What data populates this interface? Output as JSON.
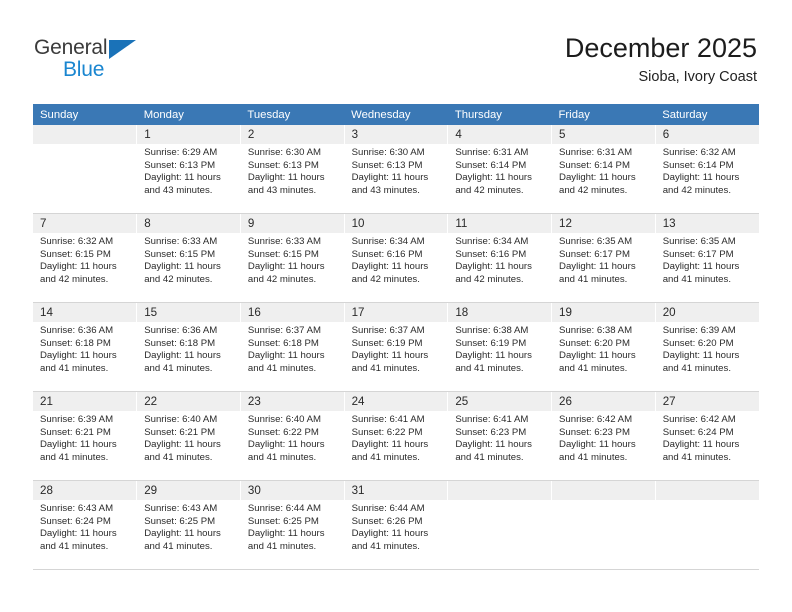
{
  "brand": {
    "name_part1": "General",
    "name_part2": "Blue",
    "triangle_color": "#1a72b8",
    "blue_text_color": "#1a86d0"
  },
  "header": {
    "title": "December 2025",
    "subtitle": "Sioba, Ivory Coast",
    "header_bg_color": "#3a78b5",
    "daynum_bg_color": "#efefef"
  },
  "weekdays": [
    "Sunday",
    "Monday",
    "Tuesday",
    "Wednesday",
    "Thursday",
    "Friday",
    "Saturday"
  ],
  "labels": {
    "sunrise_prefix": "Sunrise: ",
    "sunset_prefix": "Sunset: ",
    "daylight_prefix": "Daylight: "
  },
  "weeks": [
    [
      {
        "day": "",
        "sunrise": "",
        "sunset": "",
        "daylight_line1": "",
        "daylight_line2": ""
      },
      {
        "day": "1",
        "sunrise": "Sunrise: 6:29 AM",
        "sunset": "Sunset: 6:13 PM",
        "daylight_line1": "Daylight: 11 hours",
        "daylight_line2": "and 43 minutes."
      },
      {
        "day": "2",
        "sunrise": "Sunrise: 6:30 AM",
        "sunset": "Sunset: 6:13 PM",
        "daylight_line1": "Daylight: 11 hours",
        "daylight_line2": "and 43 minutes."
      },
      {
        "day": "3",
        "sunrise": "Sunrise: 6:30 AM",
        "sunset": "Sunset: 6:13 PM",
        "daylight_line1": "Daylight: 11 hours",
        "daylight_line2": "and 43 minutes."
      },
      {
        "day": "4",
        "sunrise": "Sunrise: 6:31 AM",
        "sunset": "Sunset: 6:14 PM",
        "daylight_line1": "Daylight: 11 hours",
        "daylight_line2": "and 42 minutes."
      },
      {
        "day": "5",
        "sunrise": "Sunrise: 6:31 AM",
        "sunset": "Sunset: 6:14 PM",
        "daylight_line1": "Daylight: 11 hours",
        "daylight_line2": "and 42 minutes."
      },
      {
        "day": "6",
        "sunrise": "Sunrise: 6:32 AM",
        "sunset": "Sunset: 6:14 PM",
        "daylight_line1": "Daylight: 11 hours",
        "daylight_line2": "and 42 minutes."
      }
    ],
    [
      {
        "day": "7",
        "sunrise": "Sunrise: 6:32 AM",
        "sunset": "Sunset: 6:15 PM",
        "daylight_line1": "Daylight: 11 hours",
        "daylight_line2": "and 42 minutes."
      },
      {
        "day": "8",
        "sunrise": "Sunrise: 6:33 AM",
        "sunset": "Sunset: 6:15 PM",
        "daylight_line1": "Daylight: 11 hours",
        "daylight_line2": "and 42 minutes."
      },
      {
        "day": "9",
        "sunrise": "Sunrise: 6:33 AM",
        "sunset": "Sunset: 6:15 PM",
        "daylight_line1": "Daylight: 11 hours",
        "daylight_line2": "and 42 minutes."
      },
      {
        "day": "10",
        "sunrise": "Sunrise: 6:34 AM",
        "sunset": "Sunset: 6:16 PM",
        "daylight_line1": "Daylight: 11 hours",
        "daylight_line2": "and 42 minutes."
      },
      {
        "day": "11",
        "sunrise": "Sunrise: 6:34 AM",
        "sunset": "Sunset: 6:16 PM",
        "daylight_line1": "Daylight: 11 hours",
        "daylight_line2": "and 42 minutes."
      },
      {
        "day": "12",
        "sunrise": "Sunrise: 6:35 AM",
        "sunset": "Sunset: 6:17 PM",
        "daylight_line1": "Daylight: 11 hours",
        "daylight_line2": "and 41 minutes."
      },
      {
        "day": "13",
        "sunrise": "Sunrise: 6:35 AM",
        "sunset": "Sunset: 6:17 PM",
        "daylight_line1": "Daylight: 11 hours",
        "daylight_line2": "and 41 minutes."
      }
    ],
    [
      {
        "day": "14",
        "sunrise": "Sunrise: 6:36 AM",
        "sunset": "Sunset: 6:18 PM",
        "daylight_line1": "Daylight: 11 hours",
        "daylight_line2": "and 41 minutes."
      },
      {
        "day": "15",
        "sunrise": "Sunrise: 6:36 AM",
        "sunset": "Sunset: 6:18 PM",
        "daylight_line1": "Daylight: 11 hours",
        "daylight_line2": "and 41 minutes."
      },
      {
        "day": "16",
        "sunrise": "Sunrise: 6:37 AM",
        "sunset": "Sunset: 6:18 PM",
        "daylight_line1": "Daylight: 11 hours",
        "daylight_line2": "and 41 minutes."
      },
      {
        "day": "17",
        "sunrise": "Sunrise: 6:37 AM",
        "sunset": "Sunset: 6:19 PM",
        "daylight_line1": "Daylight: 11 hours",
        "daylight_line2": "and 41 minutes."
      },
      {
        "day": "18",
        "sunrise": "Sunrise: 6:38 AM",
        "sunset": "Sunset: 6:19 PM",
        "daylight_line1": "Daylight: 11 hours",
        "daylight_line2": "and 41 minutes."
      },
      {
        "day": "19",
        "sunrise": "Sunrise: 6:38 AM",
        "sunset": "Sunset: 6:20 PM",
        "daylight_line1": "Daylight: 11 hours",
        "daylight_line2": "and 41 minutes."
      },
      {
        "day": "20",
        "sunrise": "Sunrise: 6:39 AM",
        "sunset": "Sunset: 6:20 PM",
        "daylight_line1": "Daylight: 11 hours",
        "daylight_line2": "and 41 minutes."
      }
    ],
    [
      {
        "day": "21",
        "sunrise": "Sunrise: 6:39 AM",
        "sunset": "Sunset: 6:21 PM",
        "daylight_line1": "Daylight: 11 hours",
        "daylight_line2": "and 41 minutes."
      },
      {
        "day": "22",
        "sunrise": "Sunrise: 6:40 AM",
        "sunset": "Sunset: 6:21 PM",
        "daylight_line1": "Daylight: 11 hours",
        "daylight_line2": "and 41 minutes."
      },
      {
        "day": "23",
        "sunrise": "Sunrise: 6:40 AM",
        "sunset": "Sunset: 6:22 PM",
        "daylight_line1": "Daylight: 11 hours",
        "daylight_line2": "and 41 minutes."
      },
      {
        "day": "24",
        "sunrise": "Sunrise: 6:41 AM",
        "sunset": "Sunset: 6:22 PM",
        "daylight_line1": "Daylight: 11 hours",
        "daylight_line2": "and 41 minutes."
      },
      {
        "day": "25",
        "sunrise": "Sunrise: 6:41 AM",
        "sunset": "Sunset: 6:23 PM",
        "daylight_line1": "Daylight: 11 hours",
        "daylight_line2": "and 41 minutes."
      },
      {
        "day": "26",
        "sunrise": "Sunrise: 6:42 AM",
        "sunset": "Sunset: 6:23 PM",
        "daylight_line1": "Daylight: 11 hours",
        "daylight_line2": "and 41 minutes."
      },
      {
        "day": "27",
        "sunrise": "Sunrise: 6:42 AM",
        "sunset": "Sunset: 6:24 PM",
        "daylight_line1": "Daylight: 11 hours",
        "daylight_line2": "and 41 minutes."
      }
    ],
    [
      {
        "day": "28",
        "sunrise": "Sunrise: 6:43 AM",
        "sunset": "Sunset: 6:24 PM",
        "daylight_line1": "Daylight: 11 hours",
        "daylight_line2": "and 41 minutes."
      },
      {
        "day": "29",
        "sunrise": "Sunrise: 6:43 AM",
        "sunset": "Sunset: 6:25 PM",
        "daylight_line1": "Daylight: 11 hours",
        "daylight_line2": "and 41 minutes."
      },
      {
        "day": "30",
        "sunrise": "Sunrise: 6:44 AM",
        "sunset": "Sunset: 6:25 PM",
        "daylight_line1": "Daylight: 11 hours",
        "daylight_line2": "and 41 minutes."
      },
      {
        "day": "31",
        "sunrise": "Sunrise: 6:44 AM",
        "sunset": "Sunset: 6:26 PM",
        "daylight_line1": "Daylight: 11 hours",
        "daylight_line2": "and 41 minutes."
      },
      {
        "day": "",
        "sunrise": "",
        "sunset": "",
        "daylight_line1": "",
        "daylight_line2": ""
      },
      {
        "day": "",
        "sunrise": "",
        "sunset": "",
        "daylight_line1": "",
        "daylight_line2": ""
      },
      {
        "day": "",
        "sunrise": "",
        "sunset": "",
        "daylight_line1": "",
        "daylight_line2": ""
      }
    ]
  ]
}
